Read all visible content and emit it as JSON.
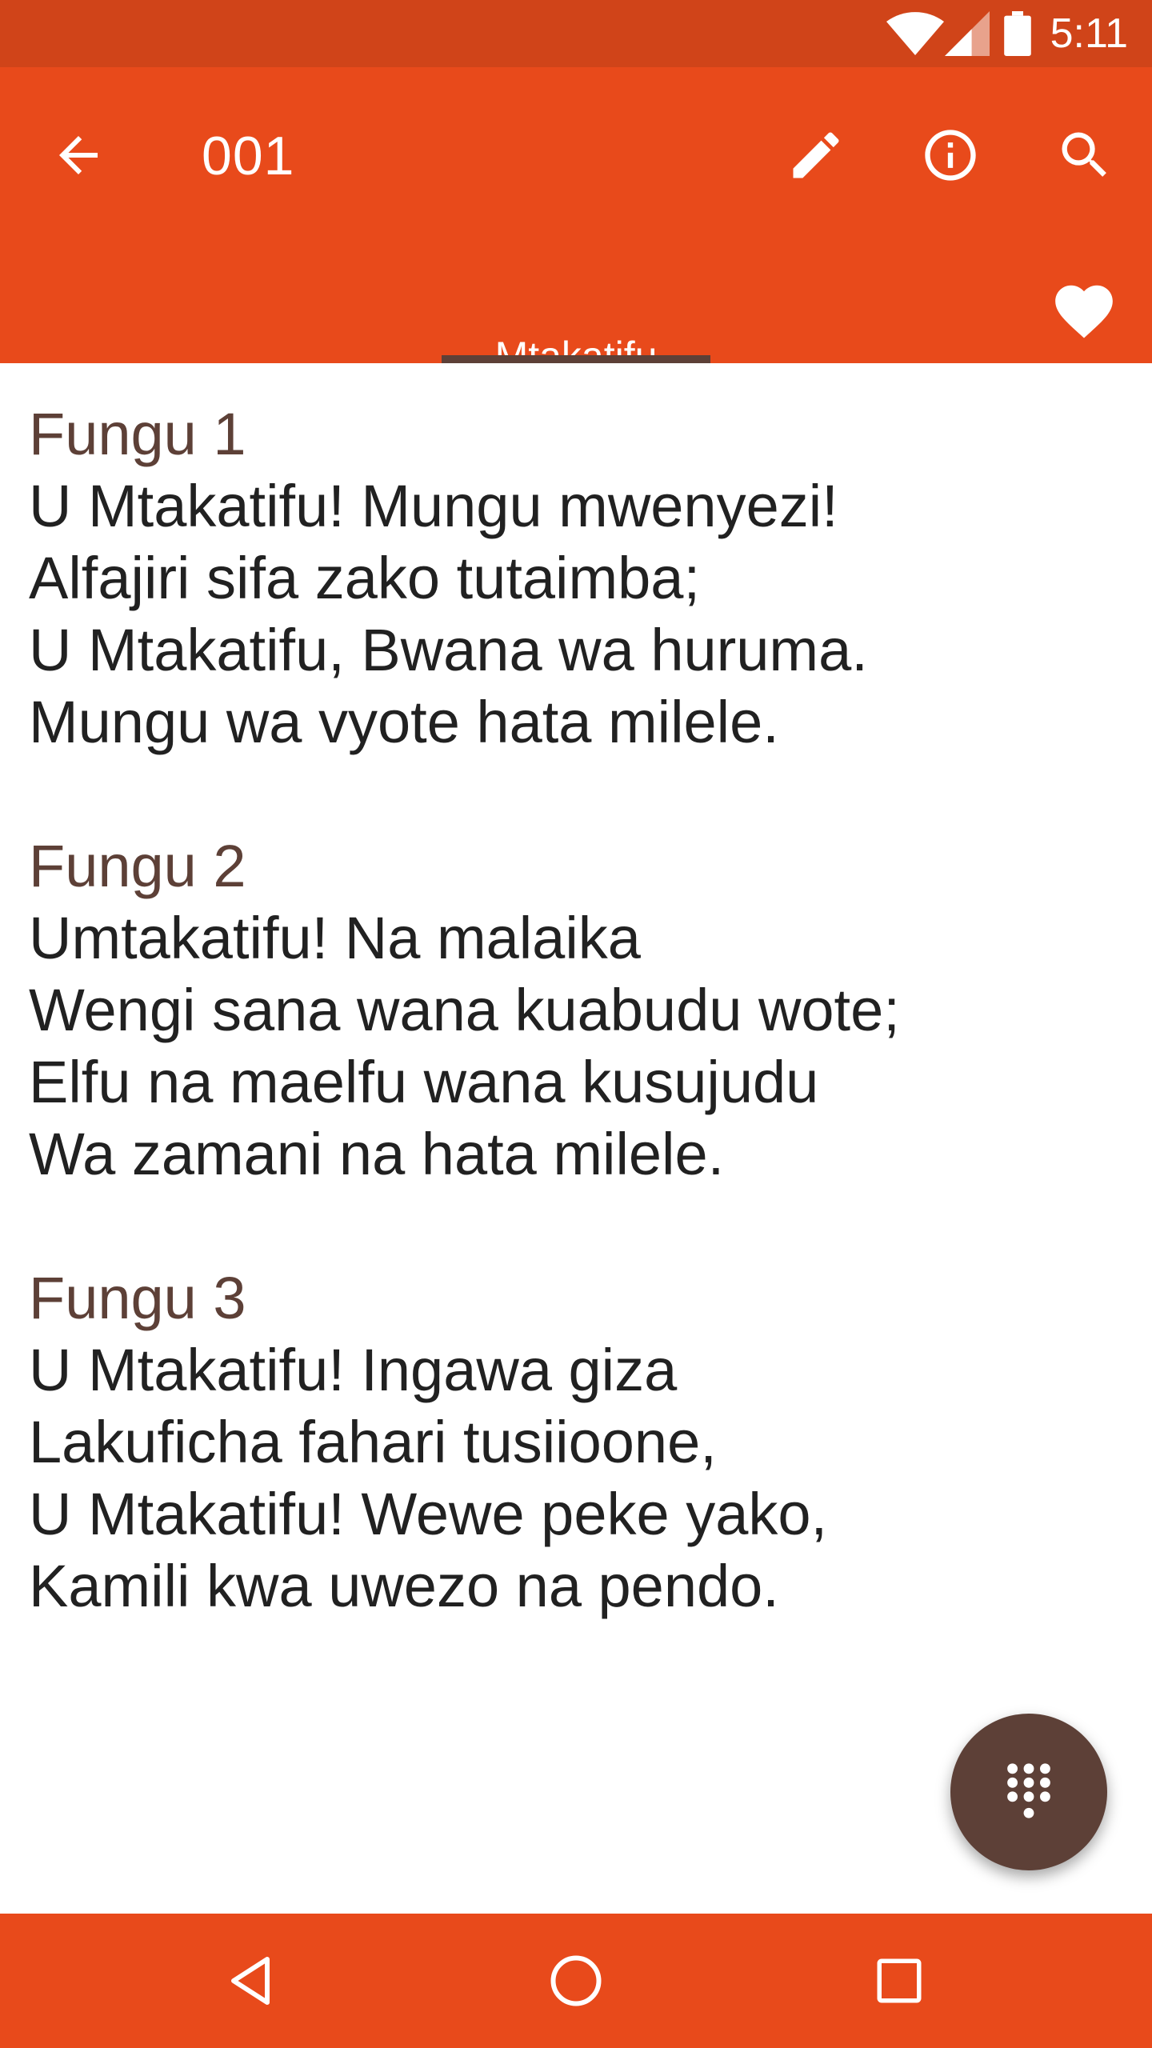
{
  "status_bar": {
    "time": "5:11"
  },
  "toolbar": {
    "title": "001"
  },
  "tabs": [
    {
      "label": "Mtakatifu"
    }
  ],
  "verses": [
    {
      "title": "Fungu 1",
      "lines": [
        "U Mtakatifu! Mungu mwenyezi!",
        "Alfajiri sifa zako tutaimba;",
        "U Mtakatifu, Bwana wa huruma.",
        "Mungu wa vyote hata milele."
      ]
    },
    {
      "title": "Fungu 2",
      "lines": [
        "Umtakatifu! Na malaika",
        "Wengi sana wana kuabudu wote;",
        "Elfu na maelfu wana kusujudu",
        "Wa zamani na hata milele."
      ]
    },
    {
      "title": "Fungu 3",
      "lines": [
        "U Mtakatifu! Ingawa giza",
        "Lakuficha fahari tusiioone,",
        "U Mtakatifu! Wewe peke yako,",
        "Kamili kwa uwezo na pendo."
      ]
    }
  ],
  "icons": {
    "back": "arrow-back-icon",
    "edit": "pencil-icon",
    "info": "info-icon",
    "search": "search-icon",
    "favorite": "heart-icon",
    "fab": "dialpad-icon",
    "nav_back": "triangle-back-icon",
    "nav_home": "circle-home-icon",
    "nav_recents": "square-recents-icon"
  },
  "colors": {
    "primary": "#E84A1B",
    "primary_dark": "#D04419",
    "accent": "#5D4037",
    "text": "#212121"
  }
}
